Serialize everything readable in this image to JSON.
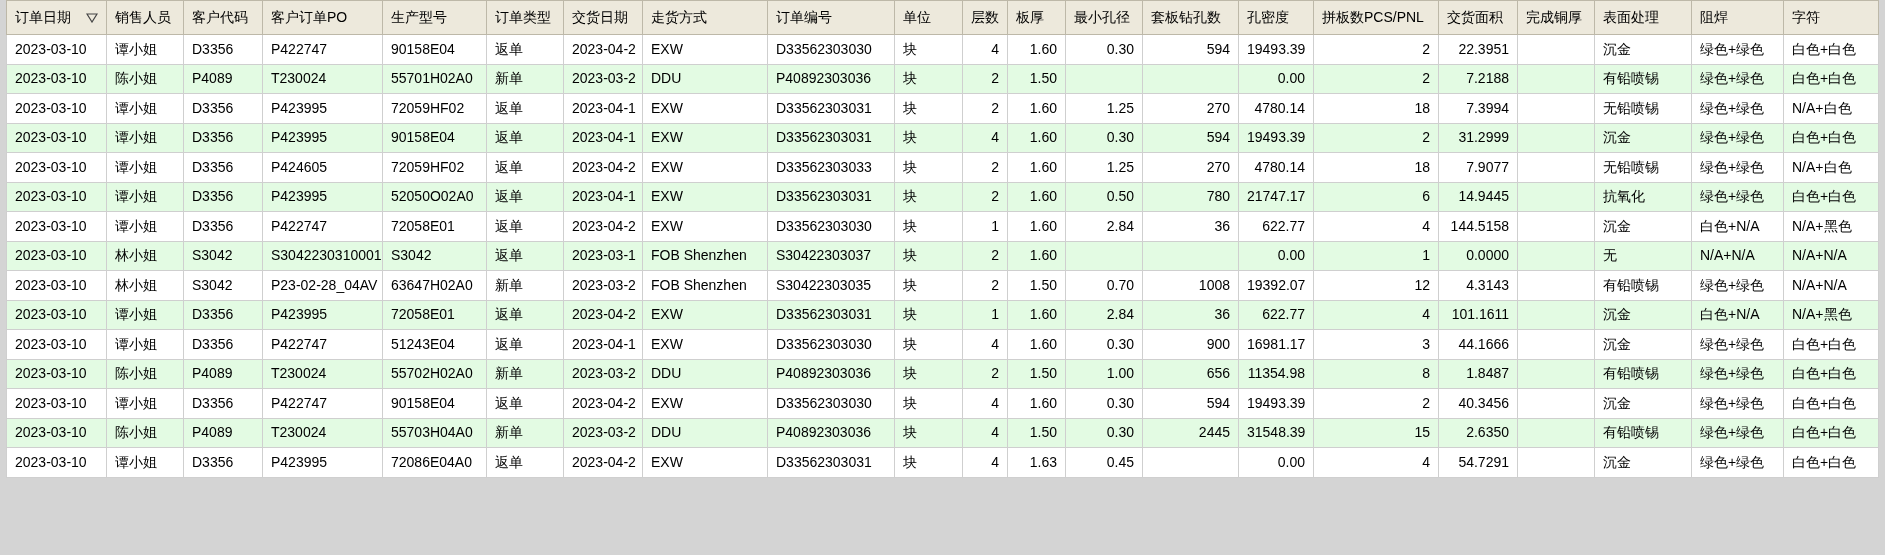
{
  "table": {
    "columns": [
      {
        "label": "订单日期",
        "kind": "text",
        "sorted": true
      },
      {
        "label": "销售人员",
        "kind": "text",
        "sorted": false
      },
      {
        "label": "客户代码",
        "kind": "text",
        "sorted": false
      },
      {
        "label": "客户订单PO",
        "kind": "text",
        "sorted": false
      },
      {
        "label": "生产型号",
        "kind": "text",
        "sorted": false
      },
      {
        "label": "订单类型",
        "kind": "text",
        "sorted": false
      },
      {
        "label": "交货日期",
        "kind": "text",
        "sorted": false
      },
      {
        "label": "走货方式",
        "kind": "text",
        "sorted": false
      },
      {
        "label": "订单编号",
        "kind": "text",
        "sorted": false
      },
      {
        "label": "单位",
        "kind": "text",
        "sorted": false
      },
      {
        "label": "层数",
        "kind": "number",
        "sorted": false
      },
      {
        "label": "板厚",
        "kind": "number",
        "sorted": false
      },
      {
        "label": "最小孔径",
        "kind": "number",
        "sorted": false
      },
      {
        "label": "套板钻孔数",
        "kind": "number",
        "sorted": false
      },
      {
        "label": "孔密度",
        "kind": "number",
        "sorted": false
      },
      {
        "label": "拼板数PCS/PNL",
        "kind": "number",
        "sorted": false
      },
      {
        "label": "交货面积",
        "kind": "number",
        "sorted": false
      },
      {
        "label": "完成铜厚",
        "kind": "text",
        "sorted": false
      },
      {
        "label": "表面处理",
        "kind": "text",
        "sorted": false
      },
      {
        "label": "阻焊",
        "kind": "text",
        "sorted": false
      },
      {
        "label": "字符",
        "kind": "text",
        "sorted": false
      }
    ],
    "rows": [
      [
        "2023-03-10",
        "谭小姐",
        "D3356",
        "P422747",
        "90158E04",
        "返单",
        "2023-04-2",
        "EXW",
        "D33562303030",
        "块",
        "4",
        "1.60",
        "0.30",
        "594",
        "19493.39",
        "2",
        "22.3951",
        null,
        "沉金",
        "绿色+绿色",
        "白色+白色"
      ],
      [
        "2023-03-10",
        "陈小姐",
        "P4089",
        "T230024",
        "55701H02A0",
        "新单",
        "2023-03-2",
        "DDU",
        "P40892303036",
        "块",
        "2",
        "1.50",
        null,
        null,
        "0.00",
        "2",
        "7.2188",
        null,
        "有铅喷锡",
        "绿色+绿色",
        "白色+白色"
      ],
      [
        "2023-03-10",
        "谭小姐",
        "D3356",
        "P423995",
        "72059HF02",
        "返单",
        "2023-04-1",
        "EXW",
        "D33562303031",
        "块",
        "2",
        "1.60",
        "1.25",
        "270",
        "4780.14",
        "18",
        "7.3994",
        null,
        "无铅喷锡",
        "绿色+绿色",
        "N/A+白色"
      ],
      [
        "2023-03-10",
        "谭小姐",
        "D3356",
        "P423995",
        "90158E04",
        "返单",
        "2023-04-1",
        "EXW",
        "D33562303031",
        "块",
        "4",
        "1.60",
        "0.30",
        "594",
        "19493.39",
        "2",
        "31.2999",
        null,
        "沉金",
        "绿色+绿色",
        "白色+白色"
      ],
      [
        "2023-03-10",
        "谭小姐",
        "D3356",
        "P424605",
        "72059HF02",
        "返单",
        "2023-04-2",
        "EXW",
        "D33562303033",
        "块",
        "2",
        "1.60",
        "1.25",
        "270",
        "4780.14",
        "18",
        "7.9077",
        null,
        "无铅喷锡",
        "绿色+绿色",
        "N/A+白色"
      ],
      [
        "2023-03-10",
        "谭小姐",
        "D3356",
        "P423995",
        "52050O02A0",
        "返单",
        "2023-04-1",
        "EXW",
        "D33562303031",
        "块",
        "2",
        "1.60",
        "0.50",
        "780",
        "21747.17",
        "6",
        "14.9445",
        null,
        "抗氧化",
        "绿色+绿色",
        "白色+白色"
      ],
      [
        "2023-03-10",
        "谭小姐",
        "D3356",
        "P422747",
        "72058E01",
        "返单",
        "2023-04-2",
        "EXW",
        "D33562303030",
        "块",
        "1",
        "1.60",
        "2.84",
        "36",
        "622.77",
        "4",
        "144.5158",
        null,
        "沉金",
        "白色+N/A",
        "N/A+黑色"
      ],
      [
        "2023-03-10",
        "林小姐",
        "S3042",
        "S3042230310001",
        "S3042",
        "返单",
        "2023-03-1",
        "FOB Shenzhen",
        "S30422303037",
        "块",
        "2",
        "1.60",
        null,
        null,
        "0.00",
        "1",
        "0.0000",
        null,
        "无",
        "N/A+N/A",
        "N/A+N/A"
      ],
      [
        "2023-03-10",
        "林小姐",
        "S3042",
        "P23-02-28_04AV",
        "63647H02A0",
        "新单",
        "2023-03-2",
        "FOB Shenzhen",
        "S30422303035",
        "块",
        "2",
        "1.50",
        "0.70",
        "1008",
        "19392.07",
        "12",
        "4.3143",
        null,
        "有铅喷锡",
        "绿色+绿色",
        "N/A+N/A"
      ],
      [
        "2023-03-10",
        "谭小姐",
        "D3356",
        "P423995",
        "72058E01",
        "返单",
        "2023-04-2",
        "EXW",
        "D33562303031",
        "块",
        "1",
        "1.60",
        "2.84",
        "36",
        "622.77",
        "4",
        "101.1611",
        null,
        "沉金",
        "白色+N/A",
        "N/A+黑色"
      ],
      [
        "2023-03-10",
        "谭小姐",
        "D3356",
        "P422747",
        "51243E04",
        "返单",
        "2023-04-1",
        "EXW",
        "D33562303030",
        "块",
        "4",
        "1.60",
        "0.30",
        "900",
        "16981.17",
        "3",
        "44.1666",
        null,
        "沉金",
        "绿色+绿色",
        "白色+白色"
      ],
      [
        "2023-03-10",
        "陈小姐",
        "P4089",
        "T230024",
        "55702H02A0",
        "新单",
        "2023-03-2",
        "DDU",
        "P40892303036",
        "块",
        "2",
        "1.50",
        "1.00",
        "656",
        "11354.98",
        "8",
        "1.8487",
        null,
        "有铅喷锡",
        "绿色+绿色",
        "白色+白色"
      ],
      [
        "2023-03-10",
        "谭小姐",
        "D3356",
        "P422747",
        "90158E04",
        "返单",
        "2023-04-2",
        "EXW",
        "D33562303030",
        "块",
        "4",
        "1.60",
        "0.30",
        "594",
        "19493.39",
        "2",
        "40.3456",
        null,
        "沉金",
        "绿色+绿色",
        "白色+白色"
      ],
      [
        "2023-03-10",
        "陈小姐",
        "P4089",
        "T230024",
        "55703H04A0",
        "新单",
        "2023-03-2",
        "DDU",
        "P40892303036",
        "块",
        "4",
        "1.50",
        "0.30",
        "2445",
        "31548.39",
        "15",
        "2.6350",
        null,
        "有铅喷锡",
        "绿色+绿色",
        "白色+白色"
      ],
      [
        "2023-03-10",
        "谭小姐",
        "D3356",
        "P423995",
        "72086E04A0",
        "返单",
        "2023-04-2",
        "EXW",
        "D33562303031",
        "块",
        "4",
        "1.63",
        "0.45",
        null,
        "0.00",
        "4",
        "54.7291",
        null,
        "沉金",
        "绿色+绿色",
        "白色+白色"
      ]
    ]
  }
}
